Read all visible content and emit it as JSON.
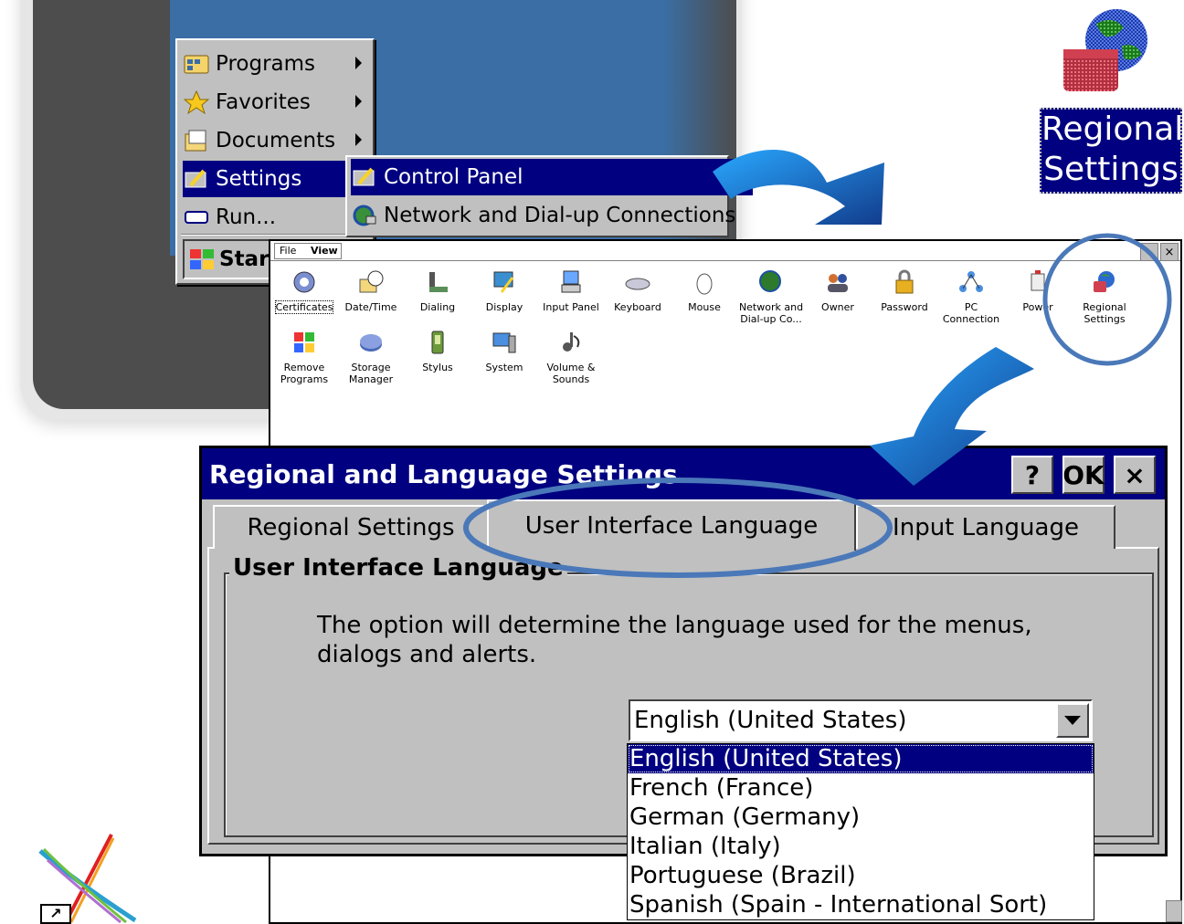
{
  "start_menu": {
    "items": [
      {
        "label": "Programs",
        "icon": "programs-icon",
        "has_submenu": true
      },
      {
        "label": "Favorites",
        "icon": "favorites-icon",
        "has_submenu": true
      },
      {
        "label": "Documents",
        "icon": "documents-icon",
        "has_submenu": true
      },
      {
        "label": "Settings",
        "icon": "settings-icon",
        "has_submenu": true,
        "selected": true
      },
      {
        "label": "Run...",
        "icon": "run-icon",
        "has_submenu": false
      }
    ],
    "submenu": [
      {
        "label": "Control Panel",
        "icon": "control-panel-icon",
        "selected": true
      },
      {
        "label": "Network and Dial-up Connections",
        "icon": "network-icon"
      }
    ],
    "start_label": "Start"
  },
  "desktop_icon": {
    "line1": "Regional",
    "line2": "Settings",
    "icon": "regional-settings-globe-icon"
  },
  "control_panel": {
    "menu": {
      "file": "File",
      "view": "View"
    },
    "close_glyph": "×",
    "items": [
      {
        "label": "Certificates",
        "icon": "certificates-icon"
      },
      {
        "label": "Date/Time",
        "icon": "date-time-icon"
      },
      {
        "label": "Dialing",
        "icon": "dialing-icon"
      },
      {
        "label": "Display",
        "icon": "display-icon"
      },
      {
        "label": "Input Panel",
        "icon": "input-panel-icon"
      },
      {
        "label": "Keyboard",
        "icon": "keyboard-icon"
      },
      {
        "label": "Mouse",
        "icon": "mouse-icon"
      },
      {
        "label": "Network and Dial-up Co...",
        "icon": "network-dialup-icon"
      },
      {
        "label": "Owner",
        "icon": "owner-icon"
      },
      {
        "label": "Password",
        "icon": "password-icon"
      },
      {
        "label": "PC Connection",
        "icon": "pc-connection-icon"
      },
      {
        "label": "Power",
        "icon": "power-icon"
      },
      {
        "label": "Regional Settings",
        "icon": "regional-settings-icon"
      },
      {
        "label": "Remove Programs",
        "icon": "remove-programs-icon"
      },
      {
        "label": "Storage Manager",
        "icon": "storage-manager-icon"
      },
      {
        "label": "Stylus",
        "icon": "stylus-icon"
      },
      {
        "label": "System",
        "icon": "system-icon"
      },
      {
        "label": "Volume & Sounds",
        "icon": "volume-sounds-icon"
      }
    ]
  },
  "dialog": {
    "title": "Regional and Language Settings",
    "help_label": "?",
    "ok_label": "OK",
    "close_label": "×",
    "tabs": [
      {
        "label": "Regional Settings",
        "active": false
      },
      {
        "label": "User Interface Language",
        "active": true
      },
      {
        "label": "Input Language",
        "active": false
      }
    ],
    "group_title": "User Interface Language",
    "description": "The option will determine the language used for the menus, dialogs and alerts.",
    "combo_value": "English (United States)",
    "options": [
      "English (United States)",
      "French (France)",
      "German (Germany)",
      "Italian (Italy)",
      "Portuguese (Brazil)",
      "Spanish (Spain - International Sort)"
    ],
    "selected_index": 0
  },
  "colors": {
    "titlebar": "#000080",
    "desktop": "#3a6ea5",
    "highlight_ellipse": "#4a78b8",
    "arrow_light": "#29a8ff",
    "arrow_dark": "#123c8c"
  }
}
